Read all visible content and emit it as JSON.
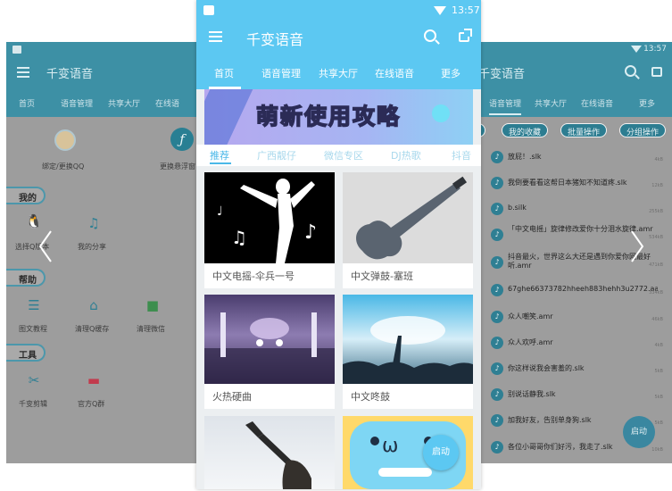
{
  "left_screen": {
    "app_title": "千变语音",
    "tabs": [
      "首页",
      "语音管理",
      "共享大厅",
      "在线语"
    ],
    "bind_qq_label": "绑定/更换QQ",
    "change_skin_label": "更换悬浮窗",
    "sections": {
      "mine": "我的",
      "help": "帮助",
      "tools": "工具"
    },
    "mine_items": [
      "选择Q版本",
      "我的分享"
    ],
    "help_items": [
      "图文教程",
      "清理Q缓存",
      "清理微信"
    ],
    "tool_items": [
      "千变剪辑",
      "官方Q群"
    ]
  },
  "center_screen": {
    "status_time": "13:57",
    "app_title": "千变语音",
    "tabs": [
      "首页",
      "语音管理",
      "共享大厅",
      "在线语音",
      "更多"
    ],
    "banner_text": "萌新使用攻略",
    "subtabs": [
      "推荐",
      "广西靓仔",
      "微信专区",
      "DJ热歌",
      "抖音"
    ],
    "cards": [
      {
        "caption": "中文电摇-伞兵一号"
      },
      {
        "caption": "中文弹鼓-塞班"
      },
      {
        "caption": "火热硬曲"
      },
      {
        "caption": "中文咚鼓"
      },
      {
        "caption": ""
      },
      {
        "caption": ""
      }
    ],
    "fab_label": "启动"
  },
  "right_screen": {
    "status_time": "13:57",
    "app_title": "千变语音",
    "tabs": [
      "语音管理",
      "共享大厅",
      "在线语音",
      "更多"
    ],
    "chips": [
      "我的收藏",
      "批量操作",
      "分组操作"
    ],
    "files": [
      {
        "name": "放屁！.slk",
        "size": "4kB"
      },
      {
        "name": "我倒要看看这帮日本猪知不知道疼.slk",
        "size": "12kB"
      },
      {
        "name": "b.silk",
        "size": "255kB"
      },
      {
        "name": "「中文电摇」旋律修改爱你十分泪水旋律.amr",
        "size": "534kB"
      },
      {
        "name": "抖音最火，世界这么大还是遇到你爱你网最好听.amr",
        "size": "471kB"
      },
      {
        "name": "67ghe66373782hheeh883hehh3u2772.aac",
        "size": "334kB"
      },
      {
        "name": "众人嘲笑.amr",
        "size": "46kB"
      },
      {
        "name": "众人欢呼.amr",
        "size": "4kB"
      },
      {
        "name": "你这样说我会害羞的.slk",
        "size": "5kB"
      },
      {
        "name": "别说话静我.slk",
        "size": "5kB"
      },
      {
        "name": "加我好友，告别单身狗.slk",
        "size": "5kB"
      },
      {
        "name": "各位小哥哥你们好污，我走了.slk",
        "size": "10kB"
      }
    ],
    "fab_label": "启动"
  },
  "colors": {
    "accent": "#5cc8f2",
    "dimmed_accent": "#3d90a5",
    "dim_background": "#9d9d9d"
  }
}
